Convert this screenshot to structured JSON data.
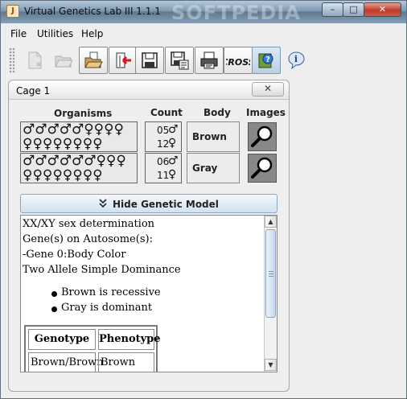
{
  "window": {
    "title": "Virtual Genetics Lab III 1.1.1",
    "watermark": "SOFTPEDIA",
    "controls": {
      "minimize": "–",
      "maximize": "□",
      "close": "✕"
    }
  },
  "menu": [
    {
      "label": "File"
    },
    {
      "label": "Utilities"
    },
    {
      "label": "Help"
    }
  ],
  "toolbar": [
    {
      "icon": "new-cross-icon",
      "enabled": false
    },
    {
      "icon": "open-folder-icon",
      "enabled": false
    },
    {
      "icon": "open-folder-icon",
      "enabled": true
    },
    {
      "icon": "exit-icon",
      "enabled": true
    },
    {
      "icon": "save-icon",
      "enabled": true
    },
    {
      "icon": "save-as-icon",
      "enabled": true
    },
    {
      "icon": "print-icon",
      "enabled": true
    },
    {
      "icon": "cross-icon",
      "label": "CROSS",
      "enabled": true
    },
    {
      "icon": "help-icon",
      "enabled": true,
      "active": true
    },
    {
      "icon": "info-icon",
      "enabled": true
    }
  ],
  "cage": {
    "title": "Cage 1",
    "close_label": "✕",
    "headers": {
      "organisms": "Organisms",
      "count": "Count",
      "body": "Body",
      "images": "Images"
    },
    "rows": [
      {
        "organisms_row1": "♂♂♂♂♂♀♀♀♀",
        "organisms_row2": "♀♀♀♀♀♀♀♀",
        "male_count": "05",
        "female_count": "12",
        "male_symbol": "♂",
        "female_symbol": "♀",
        "body": "Brown"
      },
      {
        "organisms_row1": "♂♂♂♂♂♂♀♀♀",
        "organisms_row2": "♀♀♀♀♀♀♀♀",
        "male_count": "06",
        "female_count": "11",
        "male_symbol": "♂",
        "female_symbol": "♀",
        "body": "Gray"
      }
    ],
    "hide_model_label": "Hide Genetic Model",
    "hide_model_icon": "chevron-double-up-icon",
    "model": {
      "lines": [
        "XX/XY sex determination",
        "Gene(s) on Autosome(s):",
        "-Gene 0:Body Color",
        "Two Allele Simple Dominance"
      ],
      "bullets": [
        "Brown is recessive",
        "Gray is dominant"
      ],
      "table": {
        "headers": [
          "Genotype",
          "Phenotype"
        ],
        "rows": [
          [
            "Brown/Brown",
            "Brown"
          ]
        ]
      }
    }
  }
}
